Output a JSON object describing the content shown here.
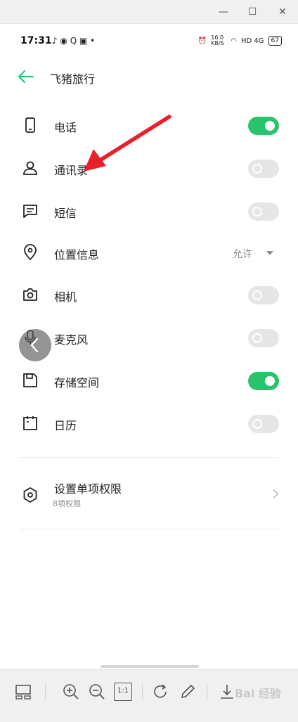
{
  "window": {
    "minimize": "—",
    "maximize": "☐",
    "close": "✕"
  },
  "status_bar": {
    "time": "17:31",
    "left_icons": "♪ ◉ Q ▣ •",
    "net_speed": "16.0 KB/S",
    "signal": "HD 4G",
    "battery": "67"
  },
  "header": {
    "title": "飞猪旅行",
    "back_icon": "back-arrow-icon"
  },
  "permissions": [
    {
      "label": "电话",
      "icon": "phone-icon",
      "enabled": true
    },
    {
      "label": "通讯录",
      "icon": "contacts-icon",
      "enabled": false
    },
    {
      "label": "短信",
      "icon": "sms-icon",
      "enabled": false
    },
    {
      "label": "位置信息",
      "icon": "location-icon",
      "value": "允许"
    },
    {
      "label": "相机",
      "icon": "camera-icon",
      "enabled": false
    },
    {
      "label": "麦克风",
      "icon": "microphone-icon",
      "enabled": false
    },
    {
      "label": "存储空间",
      "icon": "storage-icon",
      "enabled": true
    },
    {
      "label": "日历",
      "icon": "calendar-icon",
      "enabled": false
    }
  ],
  "single_permission": {
    "title": "设置单项权限",
    "subtitle": "8项权限",
    "icon": "shield-hexagon-icon"
  },
  "viewer_toolbar": {
    "actual_size": "1:1",
    "watermark": "Bai 经验"
  },
  "colors": {
    "accent": "#2ac26b",
    "arrow": "#e8202a",
    "toggle_off": "#e6e6e6"
  }
}
